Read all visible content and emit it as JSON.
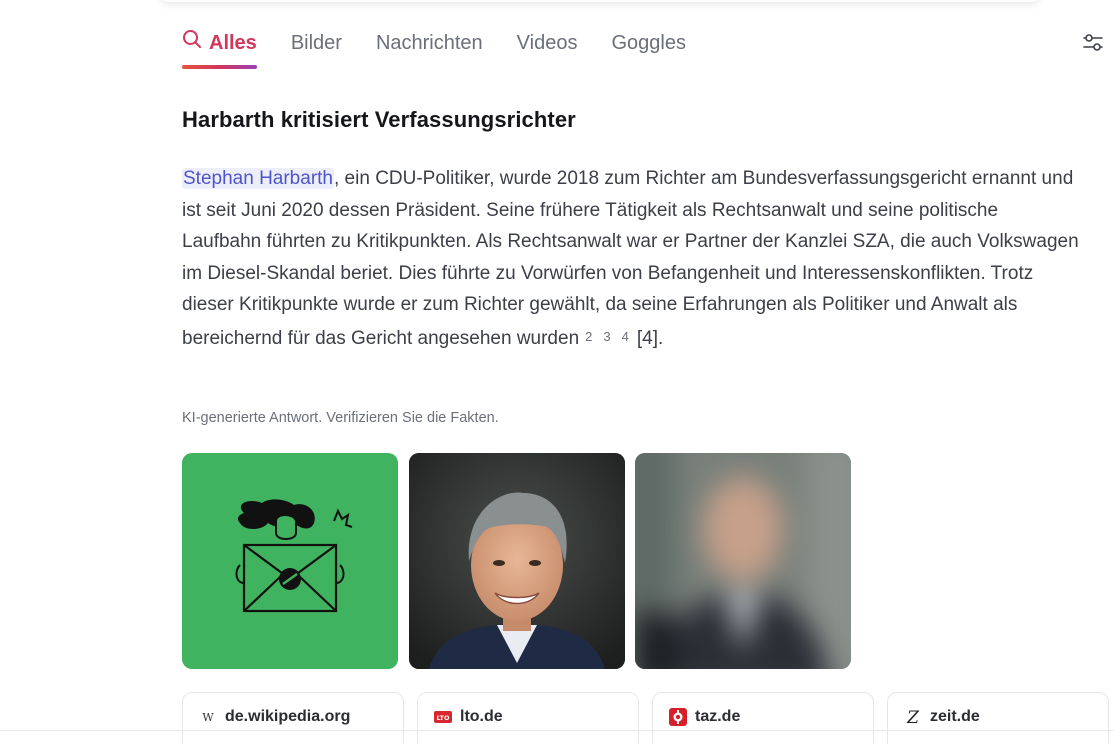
{
  "tabs": [
    {
      "label": "Alles",
      "active": true
    },
    {
      "label": "Bilder"
    },
    {
      "label": "Nachrichten"
    },
    {
      "label": "Videos"
    },
    {
      "label": "Goggles"
    }
  ],
  "settings_icon": "sliders-icon",
  "answer": {
    "title": "Harbarth kritisiert Verfassungsrichter",
    "entity": "Stephan Harbarth",
    "text": ", ein CDU-Politiker, wurde 2018 zum Richter am Bundesverfassungsgericht ernannt und ist seit Juni 2020 dessen Präsident. Seine frühere Tätigkeit als Rechtsanwalt und seine politische Laufbahn führten zu Kritikpunkten. Als Rechtsanwalt war er Partner der Kanzlei SZA, die auch Volkswagen im Diesel-Skandal beriet. Dies führte zu Vorwürfen von Befangenheit und Interessenskonflikten. Trotz dieser Kritikpunkte wurde er zum Richter gewählt, da seine Erfahrungen als Politiker und Anwalt als bereichernd für das Gericht angesehen wurden",
    "citations": [
      "2",
      "3",
      "4"
    ],
    "bracket_citation": "[4].",
    "disclaimer": "KI-generierte Antwort. Verifizieren Sie die Fakten."
  },
  "images": [
    {
      "name": "illustration-person-envelope"
    },
    {
      "name": "portrait-photo"
    },
    {
      "name": "blurred-photo"
    }
  ],
  "sources": [
    {
      "label": "de.wikipedia.org",
      "icon": "wikipedia-icon"
    },
    {
      "label": "lto.de",
      "icon": "lto-icon"
    },
    {
      "label": "taz.de",
      "icon": "taz-icon"
    },
    {
      "label": "zeit.de",
      "icon": "zeit-icon"
    }
  ],
  "colors": {
    "accent": "#d1365b",
    "link": "#4f55c8",
    "image_green": "#3fb35f"
  }
}
